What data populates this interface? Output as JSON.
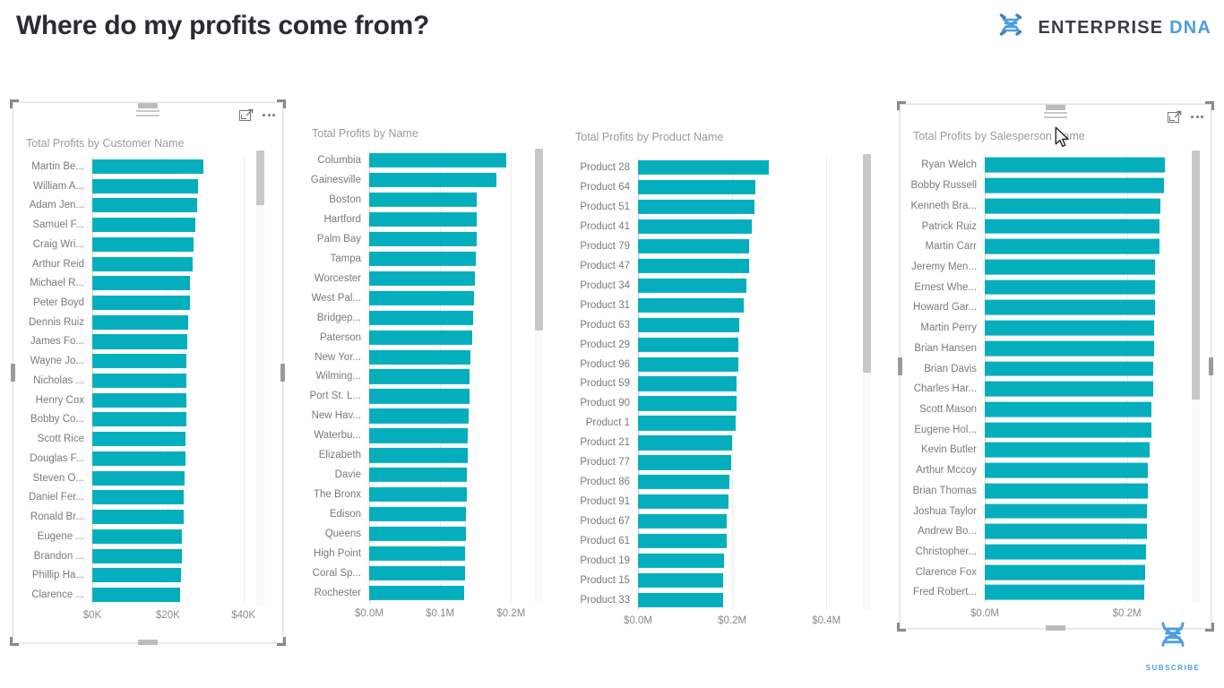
{
  "header": {
    "title": "Where do my profits come from?",
    "brand_primary": "ENTERPRISE",
    "brand_secondary": "DNA",
    "brand_icon": "dna-helix-icon",
    "accent_color": "#4d9de0",
    "title_color": "#2b2b33"
  },
  "watermark": {
    "label": "SUBSCRIBE",
    "icon": "dna-helix-icon",
    "color": "#4d9de0"
  },
  "theme": {
    "bar_color": "#05AEBC",
    "label_color": "#7a7a7a",
    "visual_title_color": "#9b9b9b",
    "gridline_color": "#ededed"
  },
  "visuals": [
    {
      "id": "customer-name",
      "title": "Total Profits by Customer Name",
      "selected": true,
      "header_actions": [
        "focus-mode-icon",
        "more-options-icon"
      ],
      "scroll_thumb_pct": 12,
      "scroll_top_pct": 0,
      "chart_data": {
        "type": "bar",
        "orientation": "horizontal",
        "title": "Total Profits by Customer Name",
        "xlabel": "",
        "ylabel": "",
        "xlim": [
          0,
          46000
        ],
        "ticks": [
          "$0K",
          "$20K",
          "$40K"
        ],
        "tick_values": [
          0,
          20000,
          40000
        ],
        "grid": true,
        "legend": false,
        "categories": [
          "Martin Be...",
          "William A...",
          "Adam Jen...",
          "Samuel F...",
          "Craig Wri...",
          "Arthur Reid",
          "Michael R...",
          "Peter Boyd",
          "Dennis Ruiz",
          "James Fo...",
          "Wayne Jo...",
          "Nicholas ...",
          "Henry Cox",
          "Bobby Co...",
          "Scott Rice",
          "Douglas F...",
          "Steven O...",
          "Daniel Fer...",
          "Ronald Br...",
          "Eugene ...",
          "Brandon ...",
          "Phillip Ha...",
          "Clarence ..."
        ],
        "values": [
          29300,
          27900,
          27800,
          27200,
          26700,
          26500,
          25900,
          25800,
          25300,
          25200,
          25000,
          25000,
          24900,
          24800,
          24700,
          24600,
          24400,
          24300,
          24200,
          23800,
          23600,
          23400,
          23300
        ]
      }
    },
    {
      "id": "name",
      "title": "Total Profits by Name",
      "selected": false,
      "header_actions": [],
      "scroll_thumb_pct": 40,
      "scroll_top_pct": 0,
      "chart_data": {
        "type": "bar",
        "orientation": "horizontal",
        "title": "Total Profits by Name",
        "xlabel": "",
        "ylabel": "",
        "xlim": [
          0,
          235000
        ],
        "ticks": [
          "$0.0M",
          "$0.1M",
          "$0.2M"
        ],
        "tick_values": [
          0,
          100000,
          200000
        ],
        "grid": true,
        "legend": false,
        "categories": [
          "Columbia",
          "Gainesville",
          "Boston",
          "Hartford",
          "Palm Bay",
          "Tampa",
          "Worcester",
          "West Pal...",
          "Bridgep...",
          "Paterson",
          "New Yor...",
          "Wilming...",
          "Port St. L...",
          "New Hav...",
          "Waterbu...",
          "Elizabeth",
          "Davie",
          "The Bronx",
          "Edison",
          "Queens",
          "High Point",
          "Coral Sp...",
          "Rochester"
        ],
        "values": [
          193000,
          180000,
          152000,
          151500,
          151000,
          150000,
          149000,
          148000,
          146000,
          145500,
          143000,
          142000,
          141500,
          140000,
          139500,
          139000,
          138000,
          137500,
          136500,
          136000,
          135500,
          135000,
          134500
        ]
      }
    },
    {
      "id": "product-name",
      "title": "Total Profits by Product Name",
      "selected": false,
      "header_actions": [],
      "scroll_thumb_pct": 48,
      "scroll_top_pct": 0,
      "chart_data": {
        "type": "bar",
        "orientation": "horizontal",
        "title": "Total Profits by Product Name",
        "xlabel": "",
        "ylabel": "",
        "xlim": [
          0,
          470000
        ],
        "ticks": [
          "$0.0M",
          "$0.2M",
          "$0.4M"
        ],
        "tick_values": [
          0,
          200000,
          400000
        ],
        "grid": true,
        "legend": false,
        "categories": [
          "Product 28",
          "Product 64",
          "Product 51",
          "Product 41",
          "Product 79",
          "Product 47",
          "Product 34",
          "Product 31",
          "Product 63",
          "Product 29",
          "Product 96",
          "Product 59",
          "Product 90",
          "Product 1",
          "Product 21",
          "Product 77",
          "Product 86",
          "Product 91",
          "Product 67",
          "Product 61",
          "Product 19",
          "Product 15",
          "Product 33"
        ],
        "values": [
          277000,
          249000,
          247500,
          242000,
          236000,
          235000,
          231000,
          224000,
          215000,
          214000,
          213000,
          210000,
          209000,
          207000,
          199000,
          197000,
          194000,
          192000,
          189000,
          188000,
          182000,
          181500,
          180000
        ]
      }
    },
    {
      "id": "salesperson-name",
      "title": "Total Profits by Salesperson Name",
      "selected": true,
      "header_actions": [
        "focus-mode-icon",
        "more-options-icon"
      ],
      "scroll_thumb_pct": 55,
      "scroll_top_pct": 0,
      "chart_data": {
        "type": "bar",
        "orientation": "horizontal",
        "title": "Total Profits by Salesperson Name",
        "xlabel": "",
        "ylabel": "",
        "xlim": [
          0,
          290000
        ],
        "ticks": [
          "$0.0M",
          "$0.2M"
        ],
        "tick_values": [
          0,
          200000
        ],
        "grid": true,
        "legend": false,
        "categories": [
          "Ryan Welch",
          "Bobby Russell",
          "Kenneth Bra...",
          "Patrick Ruiz",
          "Martin Carr",
          "Jeremy Men...",
          "Ernest Whe...",
          "Howard Gar...",
          "Martin Perry",
          "Brian Hansen",
          "Brian Davis",
          "Charles Har...",
          "Scott Mason",
          "Eugene Hol...",
          "Kevin Butler",
          "Arthur Mccoy",
          "Brian Thomas",
          "Joshua Taylor",
          "Andrew Bo...",
          "Christopher...",
          "Clarence Fox",
          "Fred Robert..."
        ],
        "values": [
          253000,
          252000,
          247000,
          246000,
          246000,
          240000,
          240000,
          239000,
          238000,
          238000,
          237000,
          236500,
          235000,
          234500,
          232000,
          230000,
          229000,
          228500,
          228000,
          227000,
          226000,
          225000
        ]
      }
    }
  ]
}
